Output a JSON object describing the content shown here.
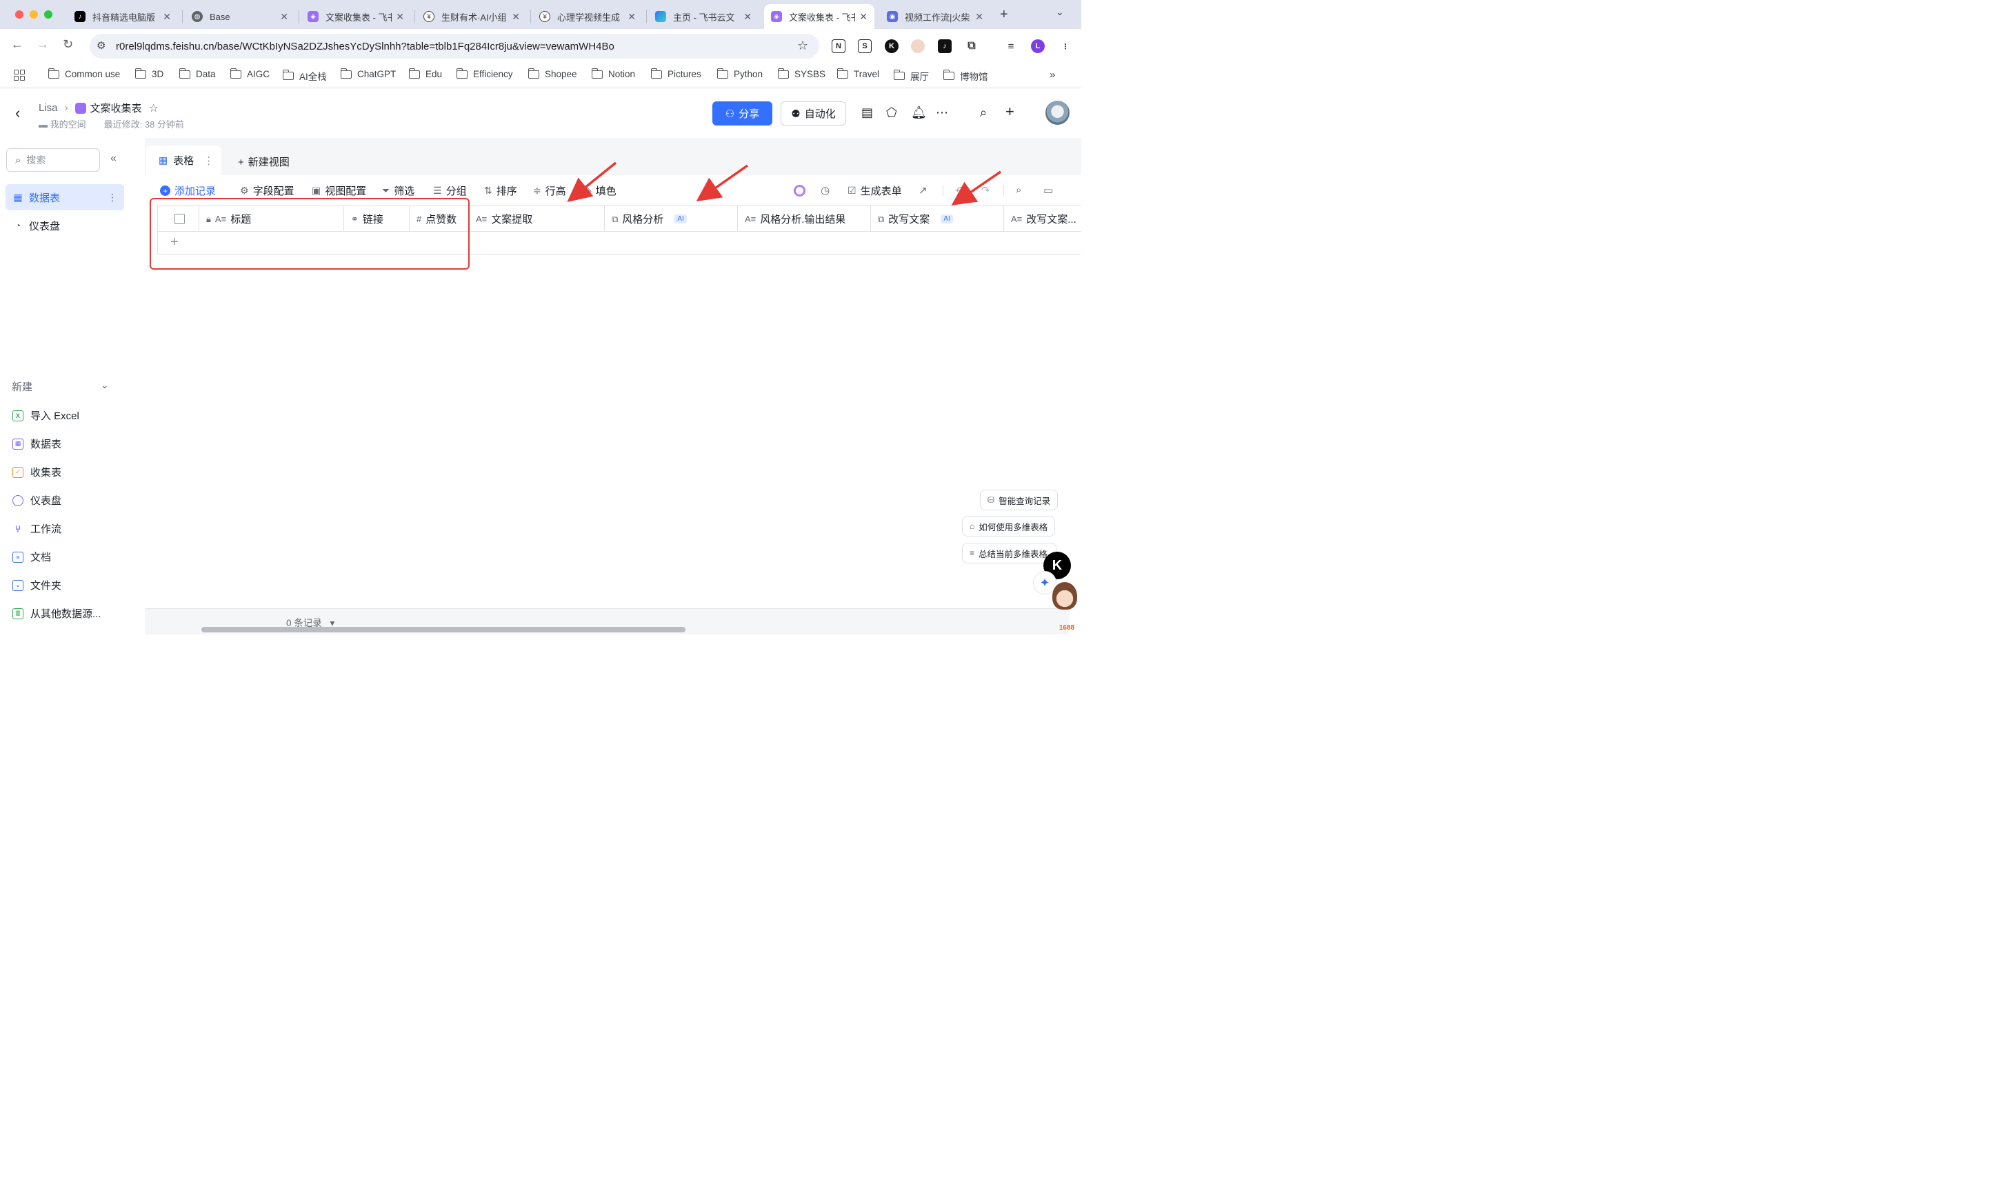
{
  "browser": {
    "tabs": [
      {
        "label": "抖音精选电脑版",
        "icon": "tiktok-icon",
        "active": false
      },
      {
        "label": "Base",
        "icon": "globe-icon",
        "active": false
      },
      {
        "label": "文案收集表 - 飞书",
        "icon": "feishu-base-icon",
        "active": false
      },
      {
        "label": "生财有术·AI小组",
        "icon": "coin-icon",
        "active": false
      },
      {
        "label": "心理学视频生成",
        "icon": "coin-icon",
        "active": false
      },
      {
        "label": "主页 - 飞书云文",
        "icon": "feishu-icon",
        "active": false
      },
      {
        "label": "文案收集表 - 飞书",
        "icon": "feishu-base-icon",
        "active": true
      },
      {
        "label": "视频工作流|火柴",
        "icon": "app-icon",
        "active": false
      }
    ],
    "url": "r0rel9lqdms.feishu.cn/base/WCtKbIyNSa2DZJshesYcDySlnhh?table=tblb1Fq284Icr8ju&view=vewamWH4Bo",
    "profile_initial": "L",
    "bookmarks": [
      "Common use",
      "3D",
      "Data",
      "AIGC",
      "AI全栈",
      "ChatGPT",
      "Edu",
      "Efficiency",
      "Shopee",
      "Notion",
      "Pictures",
      "Python",
      "SYSBS",
      "Travel",
      "展厅",
      "博物馆"
    ]
  },
  "header": {
    "breadcrumb_owner": "Lisa",
    "doc_title": "文案收集表",
    "location": "我的空间",
    "last_modified": "最近修改: 38 分钟前",
    "share_label": "分享",
    "automation_label": "自动化"
  },
  "sidebar": {
    "search_placeholder": "搜索",
    "items": [
      {
        "label": "数据表",
        "active": true
      },
      {
        "label": "仪表盘",
        "active": false
      }
    ],
    "new_section_label": "新建",
    "create_items": [
      {
        "label": "导入 Excel",
        "color": "#34a853"
      },
      {
        "label": "数据表",
        "color": "#7b61ff"
      },
      {
        "label": "收集表",
        "color": "#f08a24"
      },
      {
        "label": "仪表盘",
        "color": "#7b61ff"
      },
      {
        "label": "工作流",
        "color": "#7b61ff"
      },
      {
        "label": "文档",
        "color": "#3370ff"
      },
      {
        "label": "文件夹",
        "color": "#3370ff"
      },
      {
        "label": "从其他数据源...",
        "color": "#34a853"
      }
    ]
  },
  "view": {
    "tab_label": "表格",
    "new_view_label": "新建视图"
  },
  "toolbar": {
    "add_record": "添加记录",
    "field_config": "字段配置",
    "view_config": "视图配置",
    "filter": "筛选",
    "group": "分组",
    "sort": "排序",
    "row_height": "行高",
    "fill_color": "填色",
    "generate_form": "生成表单"
  },
  "table": {
    "columns": [
      {
        "label": "标题",
        "icon": "text-field-icon",
        "ai": false
      },
      {
        "label": "链接",
        "icon": "link-icon",
        "ai": false
      },
      {
        "label": "点赞数",
        "icon": "number-icon",
        "ai": false
      },
      {
        "label": "文案提取",
        "icon": "text-field-icon",
        "ai": false
      },
      {
        "label": "风格分析",
        "icon": "ai-field-icon",
        "ai": true
      },
      {
        "label": "风格分析.输出结果",
        "icon": "ai-text-icon",
        "ai": false
      },
      {
        "label": "改写文案",
        "icon": "ai-field-icon",
        "ai": true
      },
      {
        "label": "改写文案...",
        "icon": "ai-text-icon",
        "ai": false
      }
    ],
    "ai_badge": "AI",
    "record_count": "0 条记录"
  },
  "float_actions": [
    "智能查询记录",
    "如何使用多维表格",
    "总结当前多维表格"
  ],
  "annotation_color": "#e53935"
}
